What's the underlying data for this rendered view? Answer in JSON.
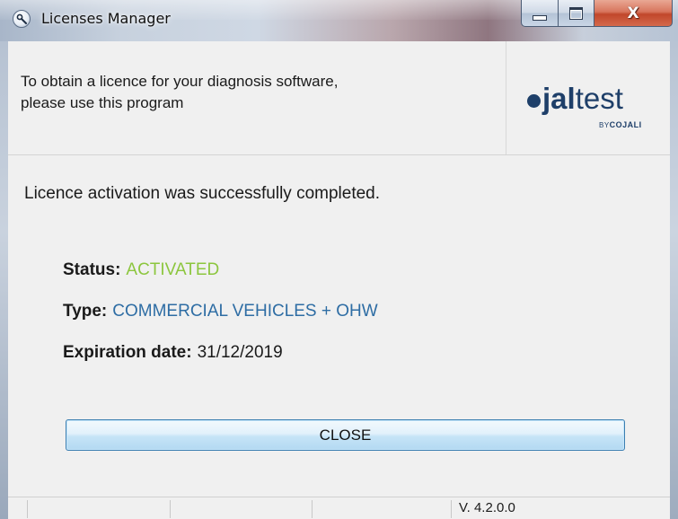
{
  "window": {
    "title": "Licenses Manager",
    "close_glyph": "X"
  },
  "header": {
    "instruction_line1": "To obtain a licence for your diagnosis software,",
    "instruction_line2": "please use this program",
    "logo": {
      "jal": "jal",
      "test": "test",
      "by": "BY",
      "cojali": "COJALI"
    }
  },
  "body": {
    "message": "Licence activation was successfully completed.",
    "status_label": "Status:",
    "status_value": "ACTIVATED",
    "type_label": "Type:",
    "type_value": "COMMERCIAL VEHICLES + OHW",
    "expiration_label": "Expiration date:",
    "expiration_value": "31/12/2019",
    "close_button": "CLOSE"
  },
  "status_bar": {
    "version": "V. 4.2.0.0"
  },
  "colors": {
    "status_value": "#8cc63e",
    "type_value": "#2e6da4",
    "brand": "#1e3f69"
  }
}
